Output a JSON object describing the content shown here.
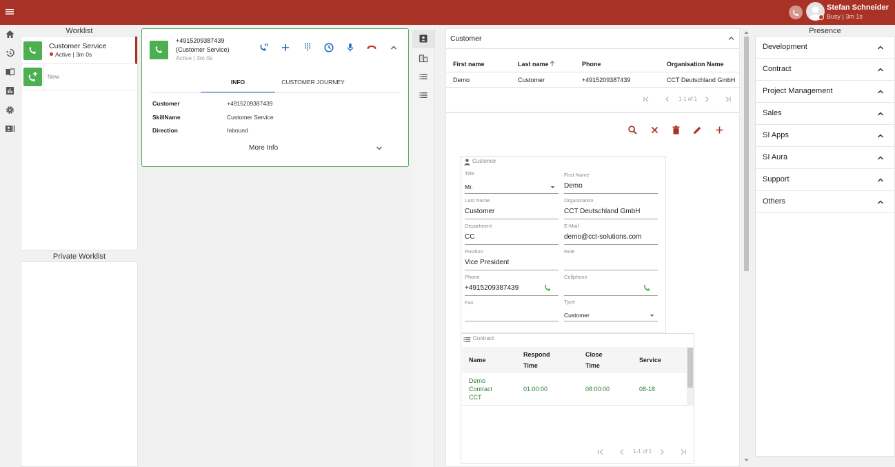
{
  "colors": {
    "brand": "#a93226",
    "accent_green": "#4caf50",
    "action_red": "#a93226"
  },
  "topbar": {
    "user_name": "Stefan Schneider",
    "user_status": "Busy | 3m 1s"
  },
  "worklist": {
    "title": "Worklist",
    "items": [
      {
        "title": "Customer Service",
        "status": "Active | 3m 0s"
      },
      {
        "title": "New"
      }
    ],
    "private_title": "Private Worklist"
  },
  "call": {
    "number": "+4915209387439",
    "skill": "(Customer Service)",
    "status": "Active | 3m 0s",
    "tabs": [
      "INFO",
      "CUSTOMER JOURNEY"
    ],
    "info": [
      {
        "label": "Customer",
        "value": "+4915209387439"
      },
      {
        "label": "SkillName",
        "value": "Customer Service"
      },
      {
        "label": "Direction",
        "value": "Inbound"
      }
    ],
    "more_info": "More Info"
  },
  "customer_panel": {
    "title": "Customer",
    "columns": [
      "First name",
      "Last name",
      "Phone",
      "Organisation Name"
    ],
    "rows": [
      [
        "Demo",
        "Customer",
        "+4915209387439",
        "CCT Deutschland GmbH"
      ]
    ],
    "pager": "1-1 of 1"
  },
  "customer_form": {
    "title": "Customer",
    "fields": {
      "title": {
        "label": "Title",
        "value": "Mr."
      },
      "first_name": {
        "label": "First Name",
        "value": "Demo"
      },
      "last_name": {
        "label": "Last Name",
        "value": "Customer"
      },
      "organization": {
        "label": "Organization",
        "value": "CCT Deutschland GmbH"
      },
      "department": {
        "label": "Department",
        "value": "CC"
      },
      "email": {
        "label": "E-Mail",
        "value": "demo@cct-solutions.com"
      },
      "position": {
        "label": "Position",
        "value": "Vice President"
      },
      "role": {
        "label": "Role",
        "value": ""
      },
      "phone": {
        "label": "Phone",
        "value": "+4915209387439"
      },
      "cellphone": {
        "label": "Cellphone",
        "value": ""
      },
      "fax": {
        "label": "Fax",
        "value": ""
      },
      "type": {
        "label": "Type",
        "value": "Customer"
      }
    }
  },
  "contract": {
    "title": "Contract",
    "col_name": "Name",
    "col_respond_1": "Respond",
    "col_respond_2": "Time",
    "col_close_1": "Close",
    "col_close_2": "Time",
    "col_service": "Service",
    "row": {
      "name_1": "Demo",
      "name_2": "Contract",
      "name_3": "CCT",
      "respond": "01:00:00",
      "close": "08:00:00",
      "service": "08-18"
    },
    "pager": "1-1 of 1"
  },
  "presence": {
    "title": "Presence",
    "groups": [
      "Development",
      "Contract",
      "Project Management",
      "Sales",
      "SI Apps",
      "SI Aura",
      "Support",
      "Others"
    ]
  }
}
